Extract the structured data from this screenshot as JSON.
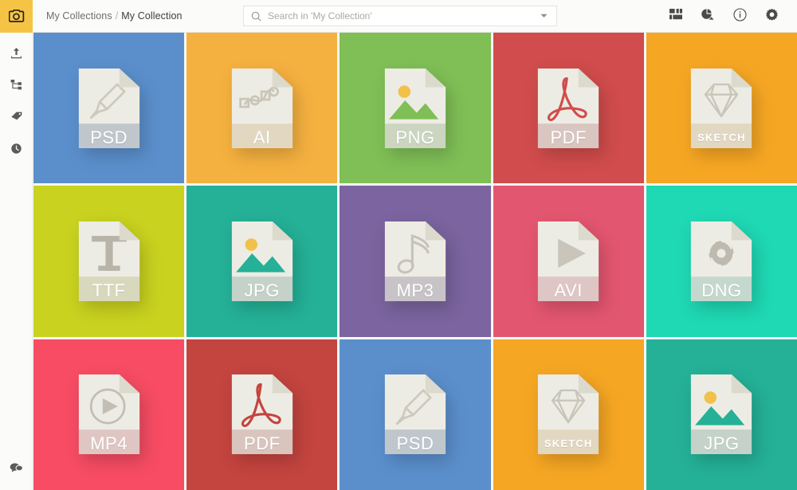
{
  "app": {
    "logo_icon": "camera-icon",
    "logo_bg": "#f5c444",
    "background": "#f7f7f5"
  },
  "header": {
    "breadcrumb": {
      "root": "My Collections",
      "separator": "/",
      "current": "My Collection"
    },
    "search": {
      "placeholder": "Search in 'My Collection'",
      "value": "",
      "icon": "search-icon",
      "caret_icon": "chevron-down-icon"
    },
    "actions": [
      {
        "name": "grid-view-button",
        "icon": "grid-icon"
      },
      {
        "name": "sort-button",
        "icon": "sort-pie-icon"
      },
      {
        "name": "info-button",
        "icon": "info-circle-icon"
      },
      {
        "name": "settings-button",
        "icon": "gear-icon"
      }
    ]
  },
  "sidebar": {
    "items": [
      {
        "name": "upload-button",
        "icon": "upload-icon"
      },
      {
        "name": "hierarchy-button",
        "icon": "tree-structure-icon"
      },
      {
        "name": "tags-button",
        "icon": "tag-icon"
      },
      {
        "name": "history-button",
        "icon": "clock-history-icon"
      }
    ],
    "bottom": [
      {
        "name": "chat-button",
        "icon": "chat-bubble-icon"
      }
    ]
  },
  "grid": {
    "columns": 5,
    "rows": 3,
    "tiles": [
      {
        "label": "PSD",
        "glyph": "paintbrush-icon",
        "bg": "#5b8fcc",
        "band": "rgba(30,70,120,0.22)",
        "glyph_color": "#cdc9bd",
        "small": false
      },
      {
        "label": "AI",
        "glyph": "pen-path-icon",
        "bg": "#f5b13f",
        "band": "rgba(170,110,20,0.16)",
        "glyph_color": "#c9c5b9",
        "small": false
      },
      {
        "label": "PNG",
        "glyph": "image-icon",
        "bg": "#7fbf56",
        "band": "rgba(50,110,30,0.18)",
        "glyph_color": "#7fbf56",
        "small": false
      },
      {
        "label": "PDF",
        "glyph": "acrobat-icon",
        "bg": "#d14c4c",
        "band": "rgba(130,25,25,0.18)",
        "glyph_color": "#d14c4c",
        "small": false
      },
      {
        "label": "SKETCH",
        "glyph": "diamond-icon",
        "bg": "#f5a623",
        "band": "rgba(170,105,10,0.16)",
        "glyph_color": "#c9c5b9",
        "small": true
      },
      {
        "label": "TTF",
        "glyph": "letter-t-icon",
        "bg": "#c8d21f",
        "band": "rgba(120,130,10,0.18)",
        "glyph_color": "#b8b4a8",
        "small": false
      },
      {
        "label": "JPG",
        "glyph": "image-icon",
        "bg": "#24b197",
        "band": "rgba(10,95,80,0.18)",
        "glyph_color": "#24b197",
        "small": false
      },
      {
        "label": "MP3",
        "glyph": "music-note-icon",
        "bg": "#7b649f",
        "band": "rgba(55,35,85,0.20)",
        "glyph_color": "#c6c2b7",
        "small": false
      },
      {
        "label": "AVI",
        "glyph": "play-triangle-icon",
        "bg": "#e3566f",
        "band": "rgba(150,25,50,0.18)",
        "glyph_color": "#c9c5ba",
        "small": false
      },
      {
        "label": "DNG",
        "glyph": "aperture-icon",
        "bg": "#1fd8b4",
        "band": "rgba(10,130,105,0.18)",
        "glyph_color": "#bebaaf",
        "small": false
      },
      {
        "label": "MP4",
        "glyph": "play-circle-icon",
        "bg": "#f74c63",
        "band": "rgba(165,25,45,0.18)",
        "glyph_color": "#c2beb3",
        "small": false
      },
      {
        "label": "PDF",
        "glyph": "acrobat-icon",
        "bg": "#c4443f",
        "band": "rgba(125,20,18,0.18)",
        "glyph_color": "#c4443f",
        "small": false
      },
      {
        "label": "PSD",
        "glyph": "paintbrush-icon",
        "bg": "#5b8fcc",
        "band": "rgba(30,70,120,0.22)",
        "glyph_color": "#cdc9bd",
        "small": false
      },
      {
        "label": "SKETCH",
        "glyph": "diamond-icon",
        "bg": "#f5a623",
        "band": "rgba(170,105,10,0.16)",
        "glyph_color": "#c9c5b9",
        "small": true
      },
      {
        "label": "JPG",
        "glyph": "image-icon",
        "bg": "#24b197",
        "band": "rgba(10,95,80,0.18)",
        "glyph_color": "#24b197",
        "small": false
      }
    ]
  },
  "colors": {
    "page_bg": "#f7f7f5",
    "header_bg": "#fbfbfa",
    "paper": "#edece4",
    "paper_fold": "#dcd9cd",
    "sun": "#f2c14a"
  }
}
